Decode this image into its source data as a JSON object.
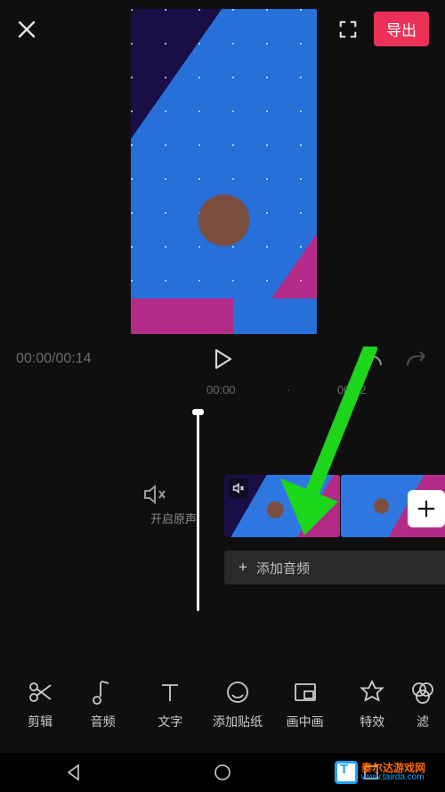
{
  "topbar": {
    "export_label": "导出"
  },
  "playback": {
    "time_label": "00:00/00:14"
  },
  "ruler": {
    "t0": "00:00",
    "t2": "00:02"
  },
  "timeline": {
    "mute_label": "开启原声",
    "add_audio_label": "添加音频"
  },
  "toolbar": {
    "items": [
      {
        "label": "剪辑"
      },
      {
        "label": "音频"
      },
      {
        "label": "文字"
      },
      {
        "label": "添加贴纸"
      },
      {
        "label": "画中画"
      },
      {
        "label": "特效"
      },
      {
        "label": "滤"
      }
    ]
  },
  "watermark": {
    "line1": "泰尔达游戏网",
    "line2": "www.tairda.com"
  },
  "colors": {
    "accent": "#ec3159",
    "annotation": "#1bd61b"
  }
}
